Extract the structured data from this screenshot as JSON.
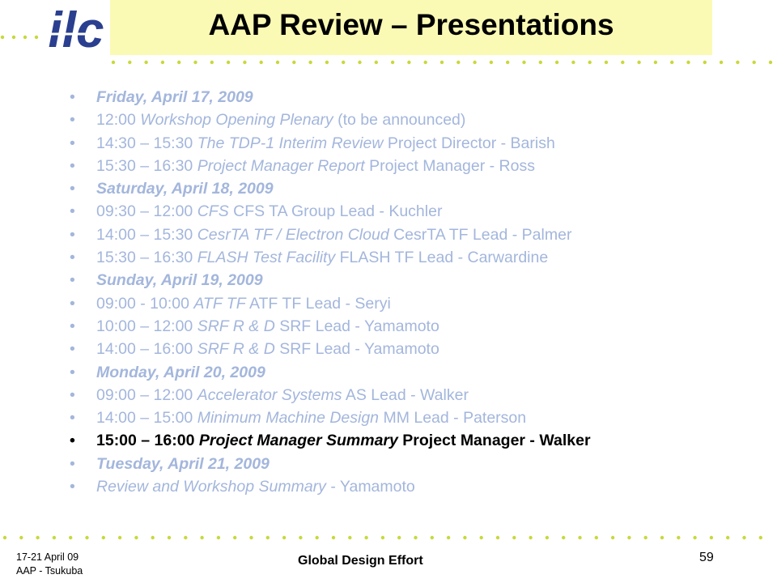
{
  "header": {
    "logo_text": "ilc",
    "title": "AAP Review – Presentations"
  },
  "colors": {
    "title_band": "#fafab4",
    "logo": "#2a3f8f",
    "dots": "#c8d83a",
    "faded_text": "#a3b6dc",
    "current_text": "#000000"
  },
  "agenda": [
    {
      "kind": "day",
      "text": "Friday, April 17, 2009"
    },
    {
      "kind": "item",
      "time": "12:00 ",
      "topic": "Workshop Opening Plenary",
      "presenter": " (to be announced)"
    },
    {
      "kind": "item",
      "time": "14:30 – 15:30 ",
      "topic": "The TDP-1 Interim Review",
      "presenter": " Project Director - Barish"
    },
    {
      "kind": "item",
      "time": "15:30 – 16:30 ",
      "topic": "Project Manager Report",
      "presenter": " Project Manager - Ross"
    },
    {
      "kind": "day",
      "text": "Saturday, April 18, 2009"
    },
    {
      "kind": "item",
      "time": "09:30 – 12:00 ",
      "topic": "CFS",
      "presenter": " CFS TA Group Lead - Kuchler"
    },
    {
      "kind": "item",
      "time": "14:00 – 15:30 ",
      "topic": "CesrTA TF / Electron Cloud",
      "presenter": " CesrTA TF Lead - Palmer"
    },
    {
      "kind": "item",
      "time": "15:30 – 16:30 ",
      "topic": "FLASH Test Facility",
      "presenter": " FLASH TF Lead - Carwardine"
    },
    {
      "kind": "day",
      "text": "Sunday, April 19, 2009"
    },
    {
      "kind": "item",
      "time": "09:00 - 10:00 ",
      "topic": "ATF TF",
      "presenter": " ATF TF Lead - Seryi"
    },
    {
      "kind": "item",
      "time": "10:00 – 12:00 ",
      "topic": "SRF R & D",
      "presenter": " SRF Lead - Yamamoto"
    },
    {
      "kind": "item",
      "time": "14:00 – 16:00 ",
      "topic": "SRF R & D",
      "presenter": " SRF Lead - Yamamoto"
    },
    {
      "kind": "day",
      "text": "Monday, April 20, 2009"
    },
    {
      "kind": "item",
      "time": "09:00 – 12:00 ",
      "topic": "Accelerator Systems",
      "presenter": " AS Lead - Walker"
    },
    {
      "kind": "item",
      "time": "14:00 – 15:00 ",
      "topic": "Minimum Machine Design",
      "presenter": " MM Lead - Paterson"
    },
    {
      "kind": "current",
      "time": "15:00 – 16:00 ",
      "topic": "Project Manager Summary",
      "presenter": " Project Manager - Walker"
    },
    {
      "kind": "day",
      "text": "Tuesday, April 21, 2009"
    },
    {
      "kind": "item",
      "time": "",
      "topic": "Review and Workshop Summary",
      "presenter": " - Yamamoto"
    }
  ],
  "footer": {
    "date": "17-21 April 09",
    "event": "AAP - Tsukuba",
    "org": "Global Design Effort",
    "page": "59"
  }
}
